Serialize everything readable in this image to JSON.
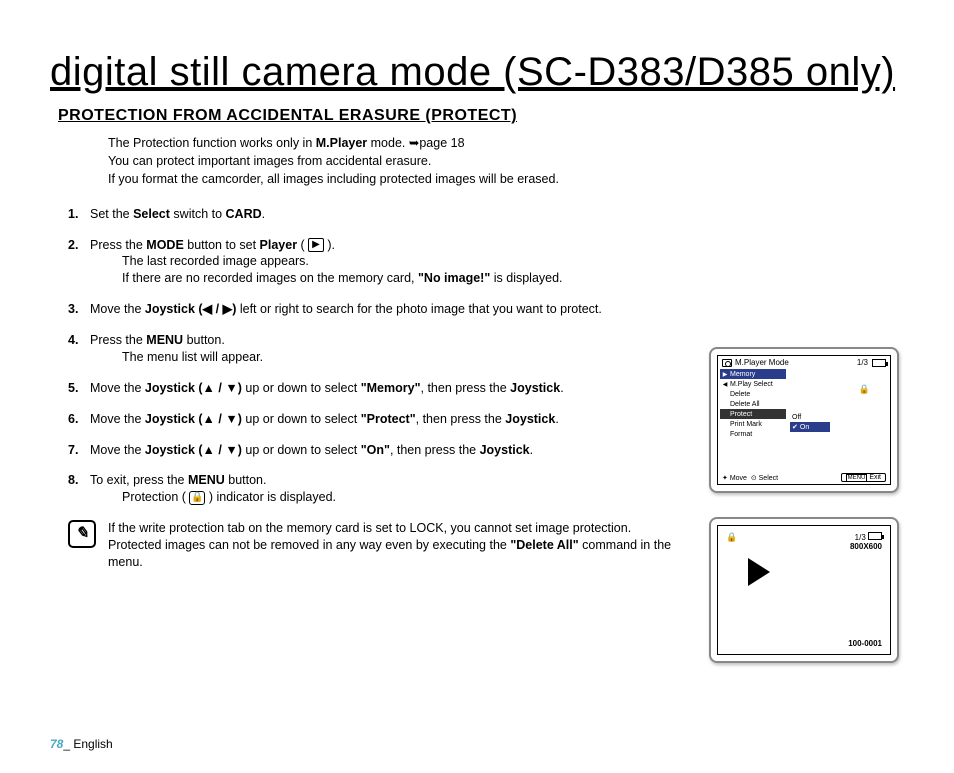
{
  "page_title": "digital still camera mode (SC-D383/D385 only)",
  "section_heading": "PROTECTION FROM ACCIDENTAL ERASURE (PROTECT)",
  "intro": {
    "line1_a": "The Protection function works only in ",
    "line1_b": "M.Player",
    "line1_c": " mode. ",
    "line1_ref": "➥page 18",
    "line2": "You can protect important images from accidental erasure.",
    "line3": "If you format the camcorder, all images including protected images will be erased."
  },
  "steps": {
    "s1a": "Set the ",
    "s1b": "Select",
    "s1c": " switch to ",
    "s1d": "CARD",
    "s1e": ".",
    "s2a": "Press the ",
    "s2b": "MODE",
    "s2c": " button to set ",
    "s2d": "Player",
    "s2e": " ( ",
    "s2f": " ).",
    "s2sub1": "The last recorded image appears.",
    "s2sub2a": "If there are no recorded images on the memory card, ",
    "s2sub2b": "\"No image!\"",
    "s2sub2c": " is displayed.",
    "s3a": "Move the ",
    "s3b": "Joystick (◀ / ▶)",
    "s3c": " left or right to search for the photo image that you want to protect.",
    "s4a": "Press the ",
    "s4b": "MENU",
    "s4c": " button.",
    "s4sub": "The menu list will appear.",
    "s5a": "Move the ",
    "s5b": "Joystick (▲ / ▼)",
    "s5c": " up or down to select ",
    "s5d": "\"Memory\"",
    "s5e": ", then press the ",
    "s5f": "Joystick",
    "s5g": ".",
    "s6a": "Move the ",
    "s6b": "Joystick (▲ / ▼)",
    "s6c": " up or down to select ",
    "s6d": "\"Protect\"",
    "s6e": ", then press the ",
    "s6f": "Joystick",
    "s6g": ".",
    "s7a": "Move the ",
    "s7b": "Joystick (▲ / ▼)",
    "s7c": " up or down to select ",
    "s7d": "\"On\"",
    "s7e": ", then press the ",
    "s7f": "Joystick",
    "s7g": ".",
    "s8a": "To exit, press the ",
    "s8b": "MENU",
    "s8c": " button.",
    "s8suba": "Protection ( ",
    "s8subb": " ) indicator is displayed."
  },
  "note": {
    "line1": "If the write protection tab on the memory card is set to LOCK, you cannot set image protection.",
    "line2a": "Protected images can not be removed in any way even by executing the ",
    "line2b": "\"Delete All\"",
    "line2c": " command in the menu."
  },
  "lcd1": {
    "title": "M.Player Mode",
    "counter": "1/3",
    "items": [
      "Memory",
      "M.Play Select",
      "Delete",
      "Delete All",
      "Protect",
      "Print Mark",
      "Format"
    ],
    "submenu": [
      "Off",
      "On"
    ],
    "footer_move": "Move",
    "footer_select": "Select",
    "footer_exit": "Exit",
    "menu_label": "MENU"
  },
  "lcd2": {
    "counter": "1/3",
    "res": "800X600",
    "file": "100-0001"
  },
  "footer": {
    "page": "78",
    "sep": "_ ",
    "lang": "English"
  }
}
